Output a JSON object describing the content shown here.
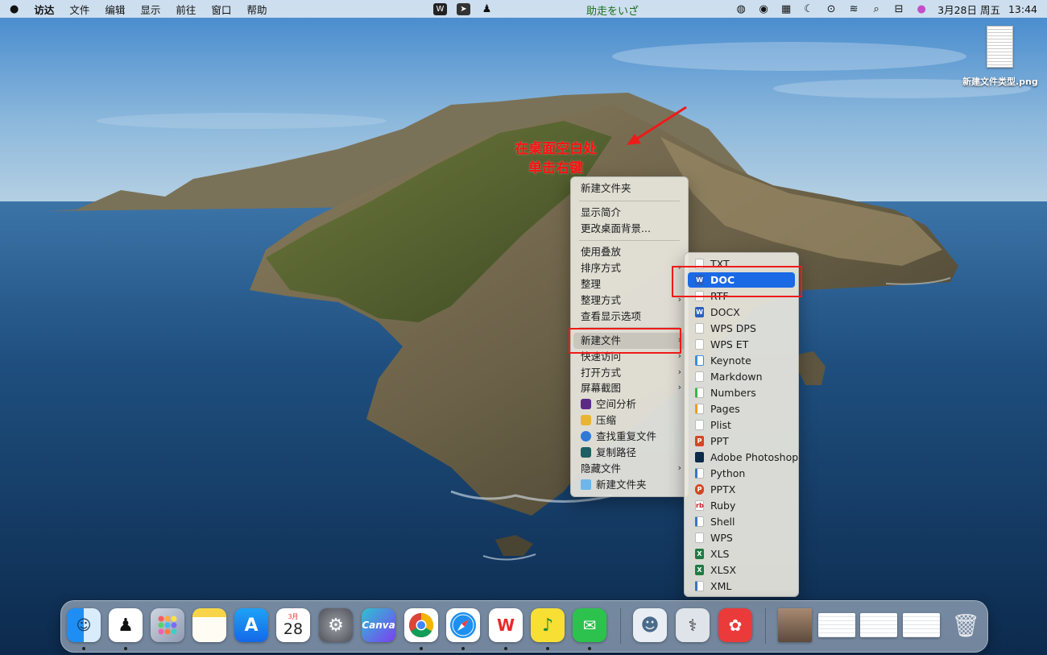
{
  "menubar": {
    "apple_icon": "apple-icon",
    "app_name": "访达",
    "menus": [
      "文件",
      "编辑",
      "显示",
      "前往",
      "窗口",
      "帮助"
    ],
    "center_title": "助走をいざ",
    "date": "3月28日 周五",
    "time": "13:44"
  },
  "desktop_file": {
    "name": "新建文件类型.png"
  },
  "annotation": {
    "line1": "在桌面空白处",
    "line2": "单击右键"
  },
  "context_menu": {
    "new_folder": "新建文件夹",
    "get_info": "显示简介",
    "change_background": "更改桌面背景...",
    "use_stacks": "使用叠放",
    "sort_by": "排序方式",
    "clean_up": "整理",
    "clean_up_by": "整理方式",
    "show_view_options": "查看显示选项",
    "new_file": "新建文件",
    "quick_access": "快速访问",
    "open_with": "打开方式",
    "screenshot": "屏幕截图",
    "space_analysis": "空间分析",
    "compress": "压缩",
    "find_duplicates": "查找重复文件",
    "copy_path": "复制路径",
    "hidden_files": "隐藏文件",
    "new_folder_2": "新建文件夹"
  },
  "submenu": {
    "items": [
      "TXT",
      "DOC",
      "RTF",
      "DOCX",
      "WPS DPS",
      "WPS ET",
      "Keynote",
      "Markdown",
      "Numbers",
      "Pages",
      "Plist",
      "PPT",
      "Adobe Photoshop",
      "Python",
      "PPTX",
      "Ruby",
      "Shell",
      "WPS",
      "XLS",
      "XLSX",
      "XML"
    ],
    "selected": "DOC"
  },
  "calendar_icon": {
    "month": "3月",
    "day": "28"
  },
  "canva_icon": {
    "label": "Canva"
  },
  "colors": {
    "accent": "#1a6ae6",
    "annotation": "#ff1010"
  }
}
